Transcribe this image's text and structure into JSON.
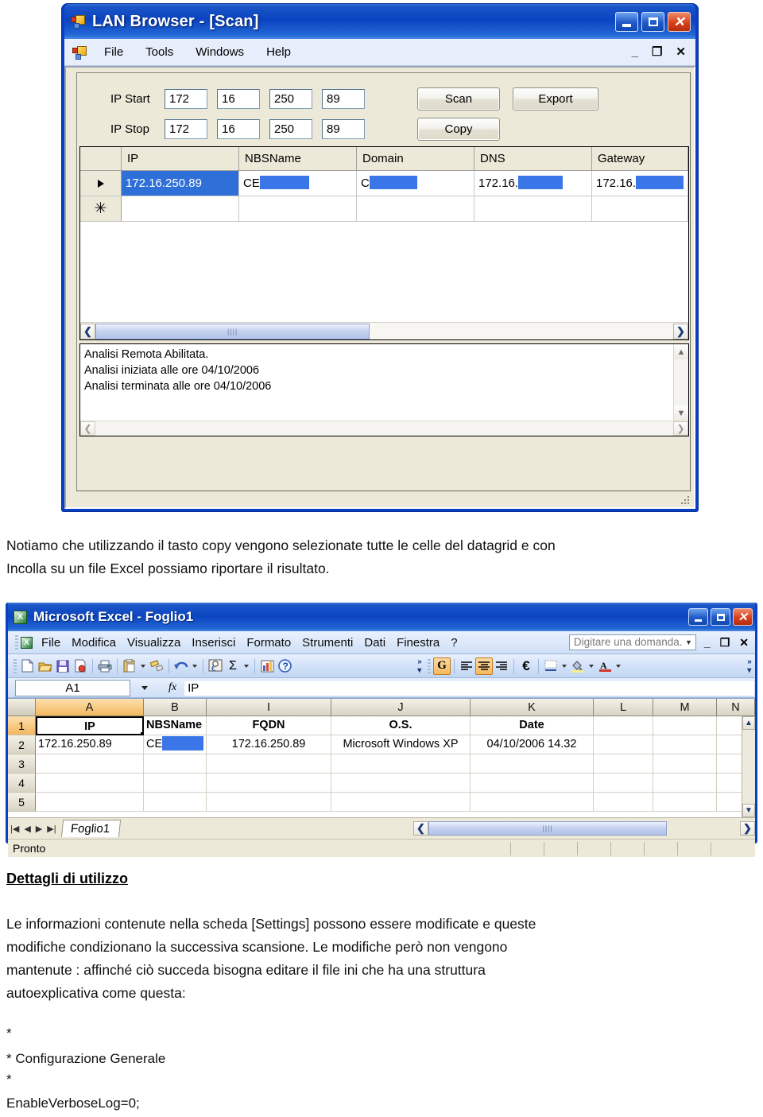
{
  "lan_window": {
    "title": "LAN Browser - [Scan]",
    "app_icon": "lan-browser-icon",
    "window_buttons": {
      "minimize": "_",
      "maximize": "□",
      "close": "✕"
    },
    "mdi_buttons": {
      "minimize": "_",
      "restore": "❐",
      "close": "✕"
    },
    "menu": [
      "File",
      "Tools",
      "Windows",
      "Help"
    ],
    "form": {
      "ip_start_label": "IP Start",
      "ip_stop_label": "IP Stop",
      "ip_start": [
        "172",
        "16",
        "250",
        "89"
      ],
      "ip_stop": [
        "172",
        "16",
        "250",
        "89"
      ],
      "buttons": {
        "scan": "Scan",
        "export": "Export",
        "copy": "Copy"
      }
    },
    "grid": {
      "columns": [
        "IP",
        "NBSName",
        "Domain",
        "DNS",
        "Gateway"
      ],
      "row": {
        "ip": "172.16.250.89",
        "nbsname_prefix": "CE",
        "domain_prefix": "C",
        "dns_prefix": "172.16.",
        "gateway_prefix": "172.16."
      },
      "row_marker": "▶",
      "new_row_marker": "✳"
    },
    "log": [
      "Analisi Remota Abilitata.",
      "Analisi iniziata alle ore 04/10/2006",
      "Analisi terminata alle ore 04/10/2006"
    ]
  },
  "caption_1": {
    "line1": "Notiamo che utilizzando il tasto copy vengono selezionate tutte le celle del datagrid e con",
    "line2": "Incolla su un file Excel possiamo riportare il risultato."
  },
  "excel_window": {
    "title": "Microsoft Excel - Foglio1",
    "icon_letter": "X",
    "window_buttons": {
      "minimize": "_",
      "maximize": "□",
      "close": "✕"
    },
    "menu": [
      "File",
      "Modifica",
      "Visualizza",
      "Inserisci",
      "Formato",
      "Strumenti",
      "Dati",
      "Finestra",
      "?"
    ],
    "ask_box_placeholder": "Digitare una domanda.",
    "mdi_buttons": {
      "minimize": "_",
      "restore": "❐",
      "close": "✕"
    },
    "toolbar_left_icons": [
      "new-icon",
      "open-icon",
      "save-icon",
      "mail-icon",
      "print-icon",
      "paste-icon",
      "format-painter-icon",
      "undo-icon",
      "euro-currency-icon",
      "autosum-icon",
      "chart-icon",
      "help-icon"
    ],
    "toolbar_right_icons": [
      "bold-G-icon",
      "align-left-icon",
      "align-center-icon",
      "align-right-icon",
      "euro-icon",
      "borders-icon",
      "fill-color-icon",
      "font-color-icon"
    ],
    "bold_button_label": "G",
    "name_box": "A1",
    "formula_value": "IP",
    "columns": [
      "A",
      "B",
      "I",
      "J",
      "K",
      "L",
      "M",
      "N"
    ],
    "row_numbers": [
      "1",
      "2",
      "3",
      "4",
      "5"
    ],
    "rows": [
      [
        "IP",
        "NBSName",
        "FQDN",
        "O.S.",
        "Date",
        "",
        "",
        ""
      ],
      [
        "172.16.250.89",
        "CE",
        "172.16.250.89",
        "Microsoft Windows XP",
        "04/10/2006 14.32",
        "",
        "",
        ""
      ],
      [
        "",
        "",
        "",
        "",
        "",
        "",
        "",
        ""
      ],
      [
        "",
        "",
        "",
        "",
        "",
        "",
        "",
        ""
      ],
      [
        "",
        "",
        "",
        "",
        "",
        "",
        "",
        ""
      ]
    ],
    "sheet_tab": "Foglio1",
    "status": "Pronto"
  },
  "section": {
    "heading": "Dettagli di utilizzo",
    "paragraph": [
      "Le informazioni contenute nella scheda [Settings] possono essere modificate e queste",
      "modifiche condizionano la successiva scansione. Le modifiche però non vengono",
      "mantenute : affinché ciò succeda bisogna editare il file ini che ha una struttura",
      "autoexplicativa come questa:"
    ],
    "ini": [
      "*",
      "*   Configurazione Generale",
      "*",
      "EnableVerboseLog=0;"
    ]
  },
  "colors": {
    "title_blue": "#0b43c0",
    "selection_blue": "#2f6fd8",
    "redaction_blue": "#3a76e8",
    "window_face": "#ece9d8",
    "excel_header": "#d8d4c4",
    "excel_selected_header": "#f3b85f"
  }
}
